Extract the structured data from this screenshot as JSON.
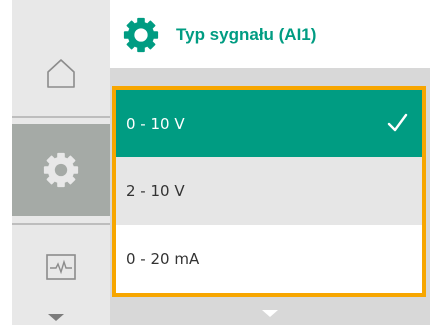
{
  "header": {
    "title": "Typ sygnału (AI1)",
    "icon": "gear-icon",
    "accent_color": "#009c82"
  },
  "sidebar": {
    "items": [
      {
        "name": "home",
        "icon": "home-icon",
        "selected": false
      },
      {
        "name": "settings",
        "icon": "gear-icon",
        "selected": true
      },
      {
        "name": "monitor",
        "icon": "pulse-icon",
        "selected": false
      }
    ],
    "scroll_down_icon": "chevron-down-icon"
  },
  "options": [
    {
      "label": "0 - 10 V",
      "selected": true,
      "check_icon": "check-icon"
    },
    {
      "label": "2 - 10 V",
      "selected": false
    },
    {
      "label": "0 - 20 mA",
      "selected": false
    }
  ],
  "colors": {
    "selection": "#009c82",
    "focus_frame": "#f7a600",
    "sidebar_active": "#a5aaa6"
  }
}
